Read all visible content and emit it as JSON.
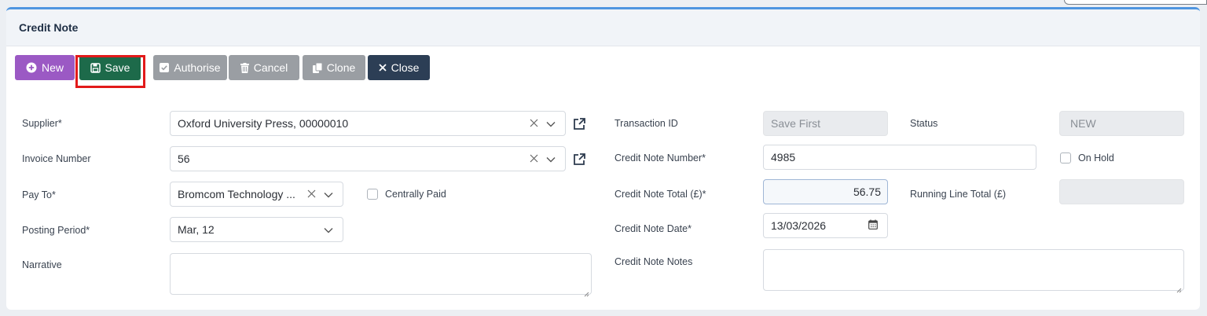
{
  "panel": {
    "title": "Credit Note"
  },
  "toolbar": {
    "new_label": "New",
    "save_label": "Save",
    "authorise_label": "Authorise",
    "cancel_label": "Cancel",
    "clone_label": "Clone",
    "close_label": "Close"
  },
  "left": {
    "supplier": {
      "label": "Supplier*",
      "value": "Oxford University Press, 00000010"
    },
    "invoice_number": {
      "label": "Invoice Number",
      "value": "56"
    },
    "pay_to": {
      "label": "Pay To*",
      "value": "Bromcom Technology ...",
      "centrally_paid_label": "Centrally Paid"
    },
    "posting_period": {
      "label": "Posting Period*",
      "value": "Mar, 12"
    },
    "narrative": {
      "label": "Narrative",
      "value": ""
    }
  },
  "right": {
    "transaction_id": {
      "label": "Transaction ID",
      "value": "Save First"
    },
    "status": {
      "label": "Status",
      "value": "NEW"
    },
    "credit_note_number": {
      "label": "Credit Note Number*",
      "value": "4985"
    },
    "on_hold_label": "On Hold",
    "credit_note_total": {
      "label": "Credit Note Total (£)*",
      "value": "56.75"
    },
    "running_line_total": {
      "label": "Running Line Total (£)",
      "value": ""
    },
    "credit_note_date": {
      "label": "Credit Note Date*",
      "value": "13/03/2026"
    },
    "credit_note_notes": {
      "label": "Credit Note Notes",
      "value": ""
    }
  },
  "colors": {
    "new": "#9b59c4",
    "save": "#1d6a4a",
    "neutral": "#9a9ea3",
    "close": "#2c3e55",
    "highlight": "#e21a1a",
    "accent_border": "#4e95e0"
  }
}
